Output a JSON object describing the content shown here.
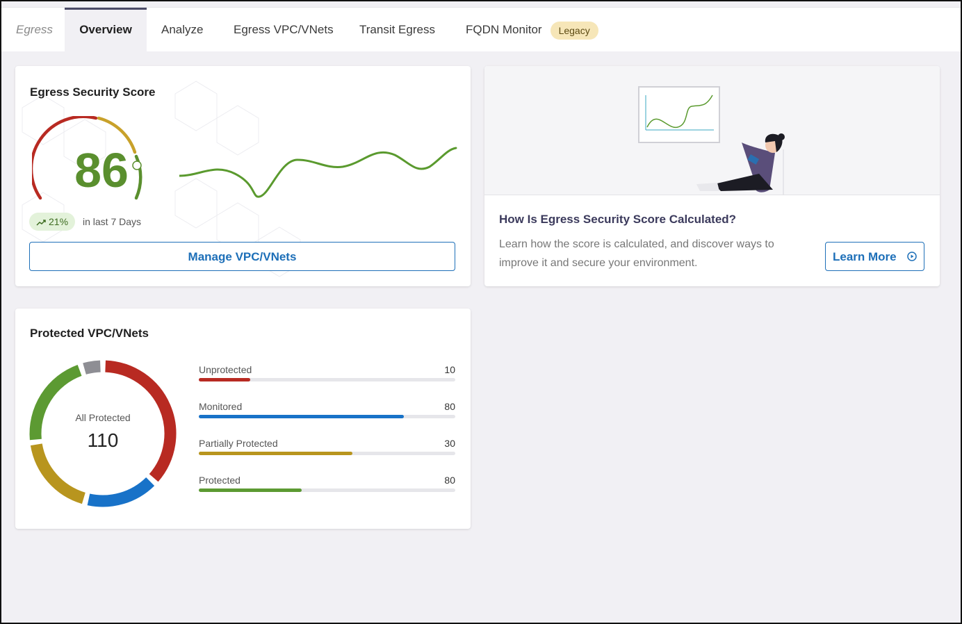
{
  "tabs": {
    "section_label": "Egress",
    "items": [
      {
        "label": "Overview",
        "active": true
      },
      {
        "label": "Analyze"
      },
      {
        "label": "Egress VPC/VNets"
      },
      {
        "label": "Transit Egress"
      },
      {
        "label": "FQDN Monitor",
        "badge": "Legacy"
      }
    ]
  },
  "score_card": {
    "title": "Egress Security Score",
    "score": "86",
    "trend_value": "21%",
    "trend_icon": "trending-up-icon",
    "trend_period": "in last 7 Days",
    "manage_button": "Manage VPC/VNets",
    "trend_series": [
      0.55,
      0.4,
      0.9,
      0.3,
      0.35,
      0.5,
      0.3,
      0.1
    ]
  },
  "info_card": {
    "title": "How Is Egress Security Score Calculated?",
    "description": "Learn how the score is calculated, and discover ways to improve it and secure your environment.",
    "learn_button": "Learn More",
    "learn_icon": "play-circle-icon"
  },
  "protected_card": {
    "title": "Protected VPC/VNets",
    "center_label": "All Protected",
    "center_value": "110",
    "stats": [
      {
        "label": "Unprotected",
        "value": "10",
        "fraction": 0.2,
        "color": "#b82a22"
      },
      {
        "label": "Monitored",
        "value": "80",
        "fraction": 0.8,
        "color": "#1872c8"
      },
      {
        "label": "Partially Protected",
        "value": "30",
        "fraction": 0.6,
        "color": "#b8951e"
      },
      {
        "label": "Protected",
        "value": "80",
        "fraction": 0.4,
        "color": "#5c9a32"
      }
    ],
    "donut_segments": [
      {
        "color": "#b82a22",
        "fraction": 0.37
      },
      {
        "color": "#1872c8",
        "fraction": 0.17
      },
      {
        "color": "#b8951e",
        "fraction": 0.19
      },
      {
        "color": "#5c9a32",
        "fraction": 0.22
      },
      {
        "color": "#8e8e94",
        "fraction": 0.05
      }
    ]
  },
  "colors": {
    "accent": "#1d6fb8",
    "score_green": "#5a8f2e",
    "gauge_red": "#b82a22",
    "gauge_gold": "#c8a12a",
    "gauge_green": "#5a8f2e"
  }
}
